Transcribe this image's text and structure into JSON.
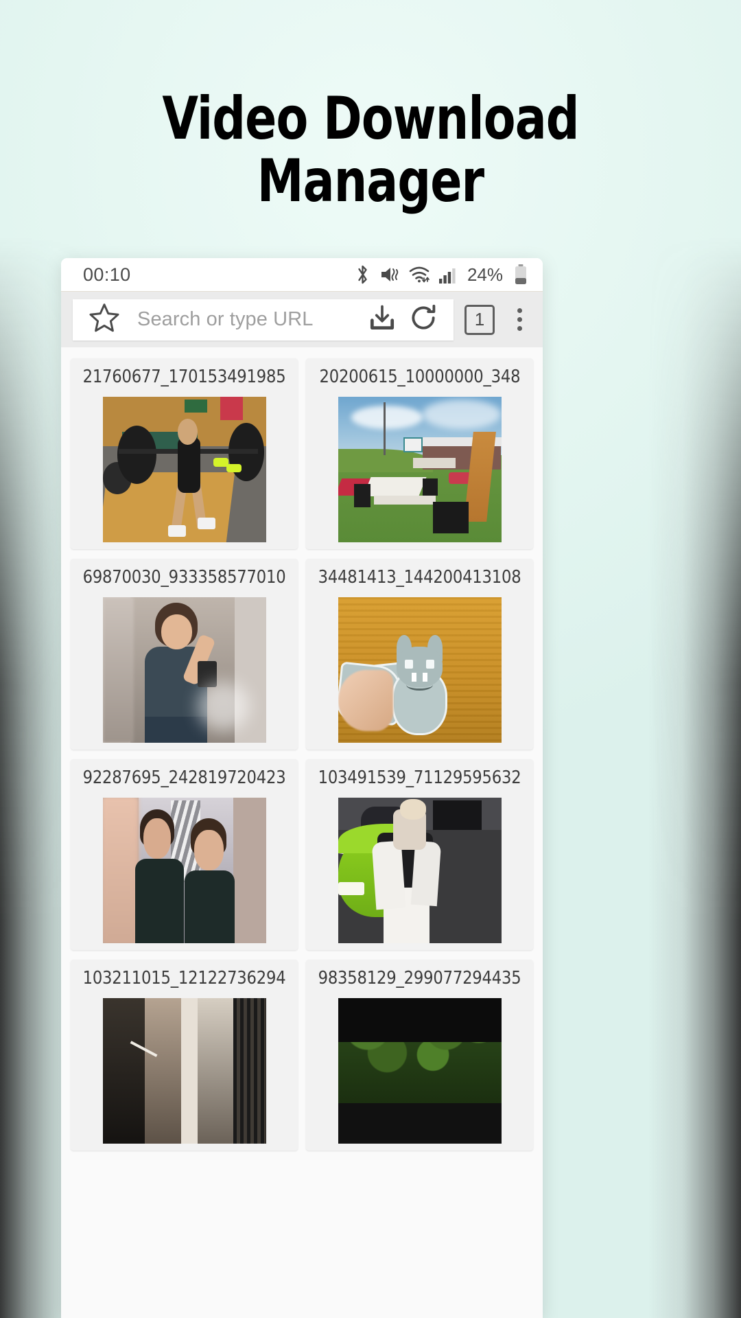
{
  "hero": {
    "title": "Video Download\nManager"
  },
  "phone": {
    "statusbar": {
      "clock": "00:10",
      "battery_percent": "24%",
      "icons": [
        "bluetooth-icon",
        "mute-vibrate-icon",
        "wifi-icon",
        "cellular-signal-icon",
        "battery-low-icon"
      ]
    },
    "browser": {
      "bookmark_icon": "star-icon",
      "url_placeholder": "Search or type URL",
      "download_icon": "download-icon",
      "reload_icon": "refresh-icon",
      "tab_count": "1",
      "menu_icon": "three-dot-menu-icon"
    },
    "videos": [
      {
        "name": "21760677_170153491985",
        "thumb": "gym-weightlifting-thumbnail"
      },
      {
        "name": "20200615_10000000_348",
        "thumb": "stadium-field-thumbnail"
      },
      {
        "name": "69870030_933358577010",
        "thumb": "mirror-selfie-thumbnail"
      },
      {
        "name": "34481413_144200413108",
        "thumb": "paper-bat-craft-thumbnail"
      },
      {
        "name": "92287695_242819720423",
        "thumb": "two-women-selfie-thumbnail"
      },
      {
        "name": "103491539_71129595632",
        "thumb": "green-sports-car-thumbnail"
      },
      {
        "name": "103211015_12122736294",
        "thumb": "dark-hallway-thumbnail"
      },
      {
        "name": "98358129_299077294435",
        "thumb": "green-foliage-thumbnail"
      }
    ]
  },
  "colors": {
    "page_background": "#e4f6f1",
    "phone_background": "#fafafa",
    "toolbar_background": "#ebebeb",
    "card_background": "#f2f2f2",
    "title_text": "#000000",
    "card_text": "#3c3c3c",
    "placeholder_text": "#9e9e9e"
  }
}
